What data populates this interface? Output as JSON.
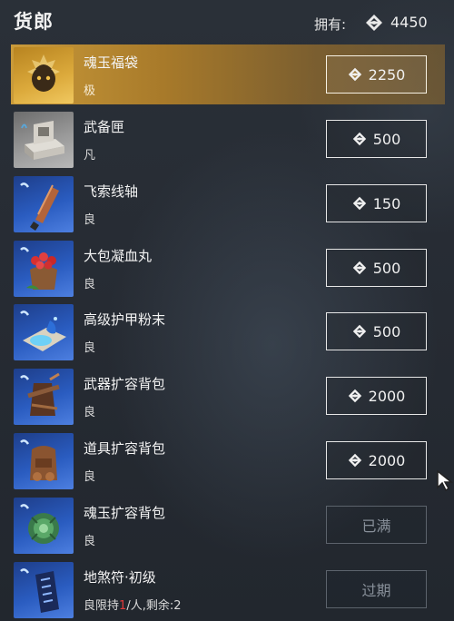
{
  "header": {
    "title": "货郎",
    "owned_label": "拥有:",
    "owned_value": "4450",
    "currency_icon": "soul-jade-icon"
  },
  "items": [
    {
      "name": "魂玉福袋",
      "grade": "极",
      "price": "2250",
      "icon": "lucky-bag-icon",
      "rarity": "epic",
      "state": "buy"
    },
    {
      "name": "武备匣",
      "grade": "凡",
      "price": "500",
      "icon": "weapon-chest-icon",
      "rarity": "common",
      "state": "buy"
    },
    {
      "name": "飞索线轴",
      "grade": "良",
      "price": "150",
      "icon": "rope-spool-icon",
      "rarity": "rare",
      "state": "buy"
    },
    {
      "name": "大包凝血丸",
      "grade": "良",
      "price": "500",
      "icon": "blood-pill-sack-icon",
      "rarity": "rare",
      "state": "buy"
    },
    {
      "name": "高级护甲粉末",
      "grade": "良",
      "price": "500",
      "icon": "armor-powder-icon",
      "rarity": "rare",
      "state": "buy"
    },
    {
      "name": "武器扩容背包",
      "grade": "良",
      "price": "2000",
      "icon": "weapon-backpack-icon",
      "rarity": "rare",
      "state": "buy"
    },
    {
      "name": "道具扩容背包",
      "grade": "良",
      "price": "2000",
      "icon": "item-backpack-icon",
      "rarity": "rare",
      "state": "buy"
    },
    {
      "name": "魂玉扩容背包",
      "grade": "良",
      "button_text": "已满",
      "icon": "jade-backpack-icon",
      "rarity": "rare",
      "state": "full"
    },
    {
      "name": "地煞符·初级",
      "grade": "良",
      "limit_prefix": "限持",
      "limit_count": "1",
      "limit_suffix": "/人,剩余:2",
      "button_text": "过期",
      "icon": "talisman-icon",
      "rarity": "rare",
      "state": "expired"
    }
  ],
  "colors": {
    "highlight_gold": "#c99a3a",
    "rare_blue": "#2a5cc0",
    "limit_red": "#e23a3a",
    "disabled_text": "#88909a"
  }
}
